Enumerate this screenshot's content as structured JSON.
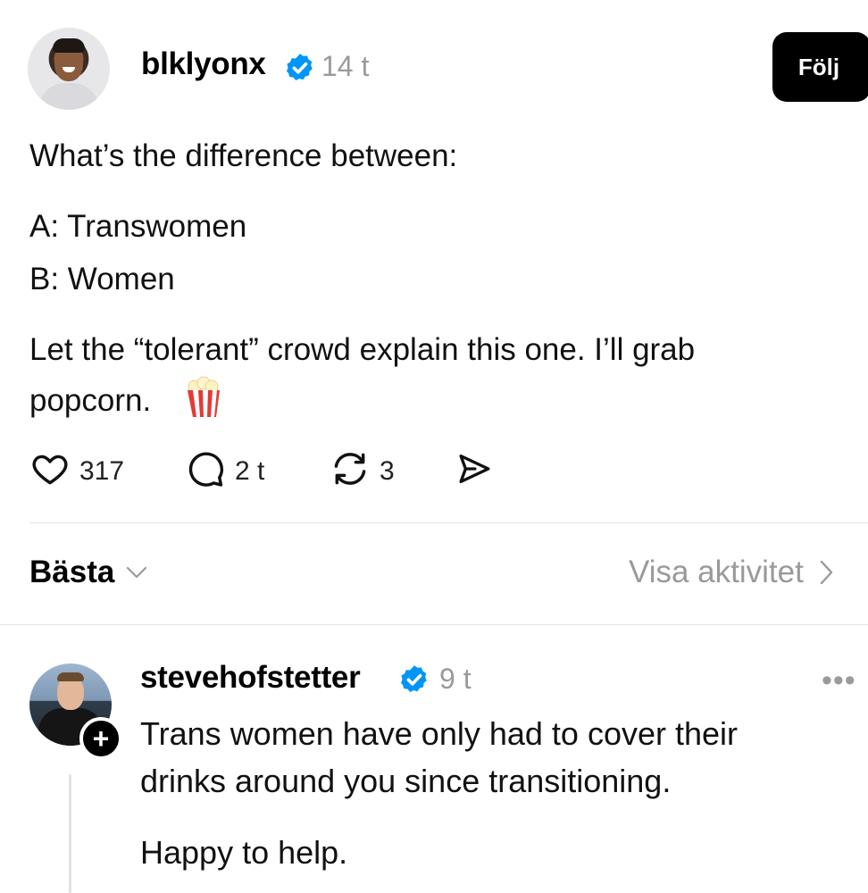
{
  "post": {
    "username": "blklyonx",
    "time": "14 t",
    "follow_label": "Följ",
    "verified_icon": "verified-badge-icon",
    "lines": [
      "What’s the difference between:",
      "A: Transwomen",
      "B: Women",
      "Let the “tolerant” crowd explain this one. I’ll grab",
      "popcorn."
    ],
    "actions": {
      "likes": "317",
      "comments": "2 t",
      "reposts": "3"
    }
  },
  "sort": {
    "label": "Bästa",
    "activity_label": "Visa aktivitet"
  },
  "reply": {
    "username": "stevehofstetter",
    "time": "9 t",
    "more_label": "•••",
    "lines": [
      "Trans women have only had to cover their",
      "drinks around you since transitioning.",
      "Happy to help."
    ],
    "add_label": "+"
  },
  "colors": {
    "verified_blue": "#0095f6",
    "muted_text": "#9a9a9a",
    "divider": "#e4e4e4"
  }
}
